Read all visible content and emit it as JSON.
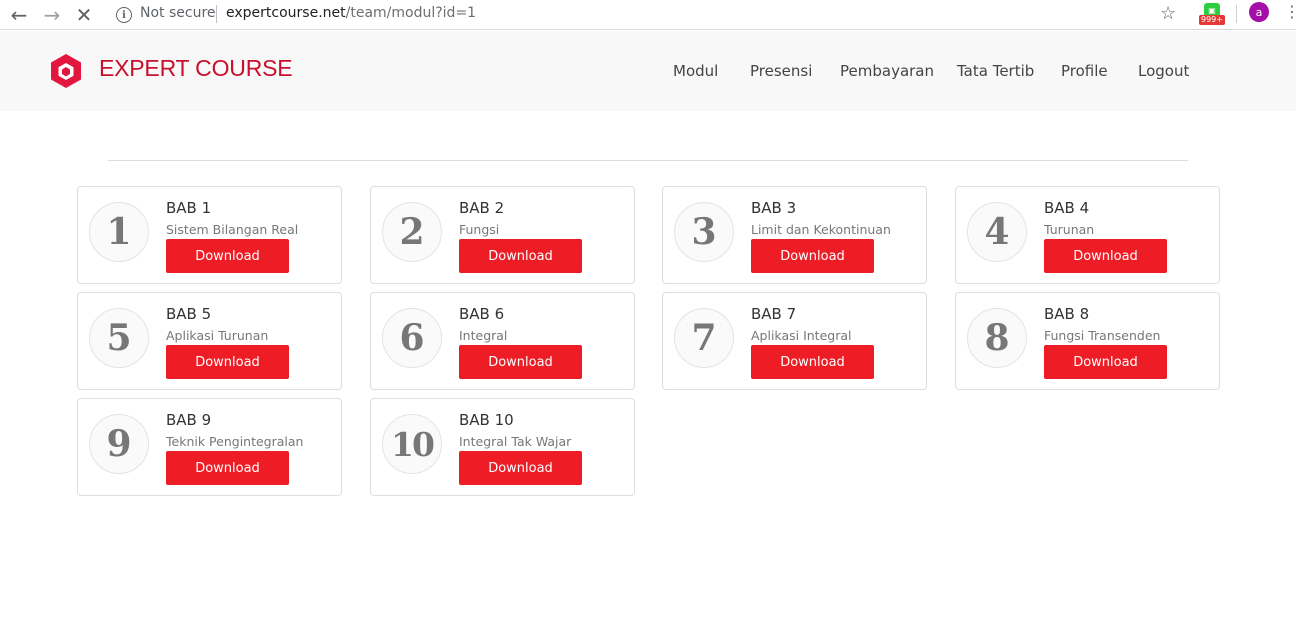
{
  "browser": {
    "security_label": "Not secure",
    "url_host": "expertcourse.net",
    "url_path": "/team/modul?id=1",
    "extension_badge": "999+",
    "profile_initial": "a"
  },
  "header": {
    "brand": "EXPERT COURSE",
    "brand_color": "#c8102e",
    "nav": [
      "Modul",
      "Presensi",
      "Pembayaran",
      "Tata Tertib",
      "Profile",
      "Logout"
    ]
  },
  "modules": [
    {
      "number": "1",
      "title": "BAB 1",
      "subtitle": "Sistem Bilangan Real",
      "button": "Download"
    },
    {
      "number": "2",
      "title": "BAB 2",
      "subtitle": "Fungsi",
      "button": "Download"
    },
    {
      "number": "3",
      "title": "BAB 3",
      "subtitle": "Limit dan Kekontinuan",
      "button": "Download"
    },
    {
      "number": "4",
      "title": "BAB 4",
      "subtitle": "Turunan",
      "button": "Download"
    },
    {
      "number": "5",
      "title": "BAB 5",
      "subtitle": "Aplikasi Turunan",
      "button": "Download"
    },
    {
      "number": "6",
      "title": "BAB 6",
      "subtitle": "Integral",
      "button": "Download"
    },
    {
      "number": "7",
      "title": "BAB 7",
      "subtitle": "Aplikasi Integral",
      "button": "Download"
    },
    {
      "number": "8",
      "title": "BAB 8",
      "subtitle": "Fungsi Transenden",
      "button": "Download"
    },
    {
      "number": "9",
      "title": "BAB 9",
      "subtitle": "Teknik Pengintegralan",
      "button": "Download"
    },
    {
      "number": "10",
      "title": "BAB 10",
      "subtitle": "Integral Tak Wajar",
      "button": "Download"
    }
  ],
  "colors": {
    "accent": "#ee1c25"
  }
}
